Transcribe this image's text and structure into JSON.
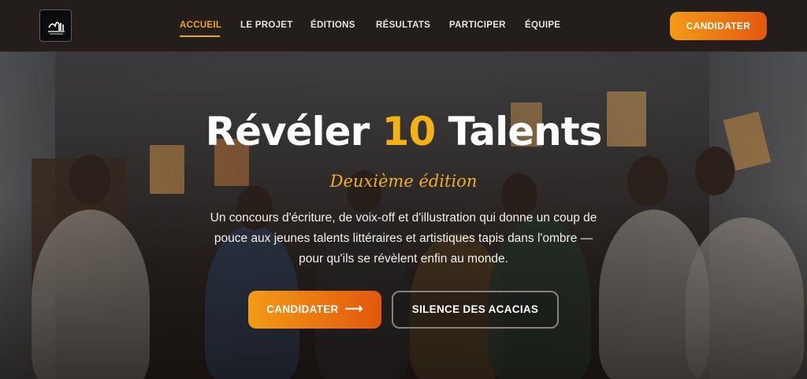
{
  "header": {
    "logo_icon": "rdt-logo-icon",
    "nav": [
      {
        "label": "ACCUEIL",
        "active": true
      },
      {
        "label": "LE PROJET",
        "active": false
      },
      {
        "label": "ÉDITIONS",
        "active": false
      },
      {
        "label": "RÉSULTATS",
        "active": false
      },
      {
        "label": "PARTICIPER",
        "active": false
      },
      {
        "label": "ÉQUIPE",
        "active": false
      }
    ],
    "cta_label": "CANDIDATER"
  },
  "hero": {
    "title_part1": "Révéler",
    "title_accent": "10",
    "title_part2": "Talents",
    "subtitle": "Deuxième édition",
    "description": "Un concours d'écriture, de voix-off et d'illustration qui donne un coup de pouce aux jeunes talents littéraires et artistiques tapis dans l'ombre — pour qu'ils se révèlent enfin au monde.",
    "primary_button": "CANDIDATER",
    "primary_button_icon": "arrow-right-icon",
    "secondary_button": "SILENCE DES ACACIAS",
    "background_image": "group-photo-young-talents-holding-books"
  },
  "colors": {
    "accent": "#f5b217",
    "button_gradient_start": "#f39b17",
    "button_gradient_end": "#e3570d",
    "header_bg": "#231e1b"
  }
}
